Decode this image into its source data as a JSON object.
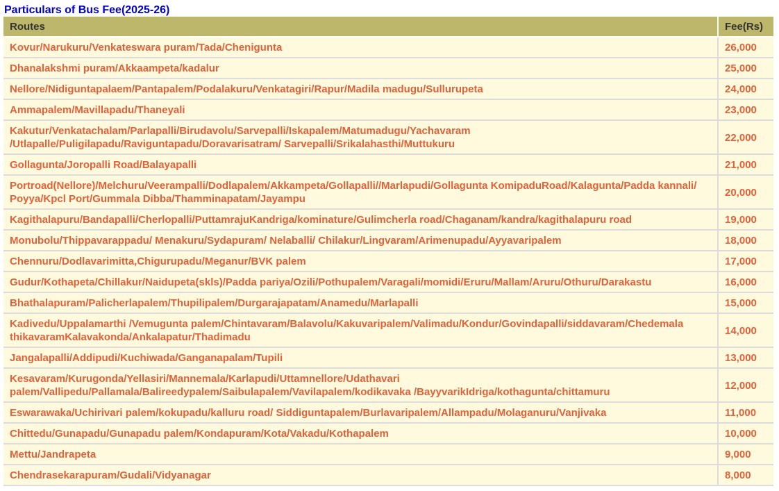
{
  "page_title": "Particulars of Bus Fee(2025-26)",
  "columns": {
    "routes": "Routes",
    "fee": "Fee(Rs)"
  },
  "colors": {
    "title": "#0000cc",
    "header_bg": "#bdb76b",
    "header_text": "#333333",
    "cell_bg": "#fffadd",
    "cell_text": "#e0613a"
  },
  "rows": [
    {
      "route": "Kovur/Narukuru/Venkateswara puram/Tada/Chenigunta",
      "fee": "26,000"
    },
    {
      "route": "Dhanalakshmi puram/Akkaampeta/kadalur",
      "fee": "25,000"
    },
    {
      "route": "Nellore/Nidiguntapalaem/Pantapalem/Podalakuru/Venkatagiri/Rapur/Madila madugu/Sullurupeta",
      "fee": "24,000"
    },
    {
      "route": "Ammapalem/Mavillapadu/Thaneyali",
      "fee": "23,000"
    },
    {
      "route": "Kakutur/Venkatachalam/Parlapalli/Birudavolu/Sarvepalli/Iskapalem/Matumadugu/Yachavaram /Utlapalle/Puligilapadu/Raviguntapadu/Doravarisatram/ Sarvepalli/Srikalahasthi/Muttukuru",
      "fee": "22,000"
    },
    {
      "route": "Gollagunta/Joropalli Road/Balayapalli",
      "fee": "21,000"
    },
    {
      "route": "Portroad(Nellore)/Melchuru/Veerampalli/Dodlapalem/Akkampeta/Gollapalli//Marlapudi/Gollagunta KomipaduRoad/Kalagunta/Padda kannali/ Poyya/Kpcl Port/Gummala Dibba/Thamminapatam/Jayampu",
      "fee": "20,000"
    },
    {
      "route": "Kagithalapuru/Bandapalli/Cherlopalli/PuttamrajuKandriga/kominature/Gulimcherla road/Chaganam/kandra/kagithalapuru road",
      "fee": "19,000"
    },
    {
      "route": "Monubolu/Thippavarappadu/ Menakuru/Sydapuram/ Nelaballi/ Chilakur/Lingvaram/Arimenupadu/Ayyavaripalem",
      "fee": "18,000"
    },
    {
      "route": "Chennuru/Dodlavarimitta,Chigurupadu/Meganur/BVK palem",
      "fee": "17,000"
    },
    {
      "route": "Gudur/Kothapeta/Chillakur/Naidupeta(skls)/Padda pariya/Ozili/Pothupalem/Varagali/momidi/Eruru/Mallam/Aruru/Othuru/Darakastu",
      "fee": "16,000"
    },
    {
      "route": "Bhathalapuram/Palicherlapalem/Thupilipalem/Durgarajapatam/Anamedu/Marlapalli",
      "fee": "15,000"
    },
    {
      "route": "Kadivedu/Uppalamarthi /Vemugunta palem/Chintavaram/Balavolu/Kakuvaripalem/Valimadu/Kondur/Govindapalli/siddavaram/Chedemala thikavaramKalavakonda/Ankalapatur/Thadimadu",
      "fee": "14,000"
    },
    {
      "route": "Jangalapalli/Addipudi/Kuchiwada/Ganganapalam/Tupili",
      "fee": "13,000"
    },
    {
      "route": "Kesavaram/Kurugonda/Yellasiri/Mannemala/Karlapudi/Uttamnellore/Udathavari palem/Vallipedu/Pallamala/Balireedypalem/Saibulapalem/Vavilapalem/kodikavaka /BayyvarikIdriga/kothagunta/chittamuru",
      "fee": "12,000"
    },
    {
      "route": "Eswarawaka/Uchirivari palem/kokupadu/kalluru road/ Siddiguntapalem/Burlavaripalem/Allampadu/Molaganuru/Vanjivaka",
      "fee": "11,000"
    },
    {
      "route": "Chittedu/Gunapadu/Gunapadu palem/Kondapuram/Kota/Vakadu/Kothapalem",
      "fee": "10,000"
    },
    {
      "route": "Mettu/Jandrapeta",
      "fee": "9,000"
    },
    {
      "route": "Chendrasekarapuram/Gudali/Vidyanagar",
      "fee": "8,000"
    }
  ]
}
